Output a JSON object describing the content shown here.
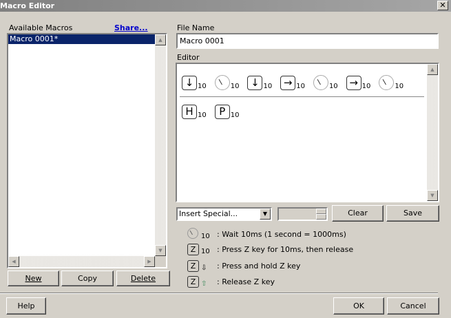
{
  "window": {
    "title": "Macro Editor",
    "close": "✕"
  },
  "left": {
    "label": "Available Macros",
    "share": "Share...",
    "macros": [
      {
        "name": "Macro 0001*",
        "selected": true
      }
    ],
    "buttons": {
      "new": "New",
      "copy": "Copy",
      "delete": "Delete"
    }
  },
  "file": {
    "label": "File Name",
    "value": "Macro 0001"
  },
  "editor": {
    "label": "Editor",
    "row1": [
      {
        "type": "key",
        "glyph": "↓",
        "ms": "10"
      },
      {
        "type": "wait",
        "ms": "10"
      },
      {
        "type": "key",
        "glyph": "↓",
        "ms": "10"
      },
      {
        "type": "key",
        "glyph": "→",
        "ms": "10"
      },
      {
        "type": "wait",
        "ms": "10"
      },
      {
        "type": "key",
        "glyph": "→",
        "ms": "10"
      },
      {
        "type": "wait",
        "ms": "10"
      }
    ],
    "row2": [
      {
        "type": "key",
        "glyph": "H",
        "ms": "10"
      },
      {
        "type": "key",
        "glyph": "P",
        "ms": "10"
      }
    ]
  },
  "controls": {
    "insert_special": "Insert Special...",
    "spin_value": "",
    "clear": "Clear",
    "save": "Save"
  },
  "legend": [
    {
      "icon": "clock",
      "suffix": "10",
      "text": ": Wait 10ms (1 second = 1000ms)"
    },
    {
      "icon": "key",
      "key": "Z",
      "suffix": "10",
      "text": ": Press Z key for 10ms, then release"
    },
    {
      "icon": "key",
      "key": "Z",
      "suffix": "⇩",
      "text": ": Press and hold Z key"
    },
    {
      "icon": "key",
      "key": "Z",
      "suffix": "⇧",
      "text": ": Release Z key"
    }
  ],
  "footer": {
    "help": "Help",
    "ok": "OK",
    "cancel": "Cancel"
  }
}
